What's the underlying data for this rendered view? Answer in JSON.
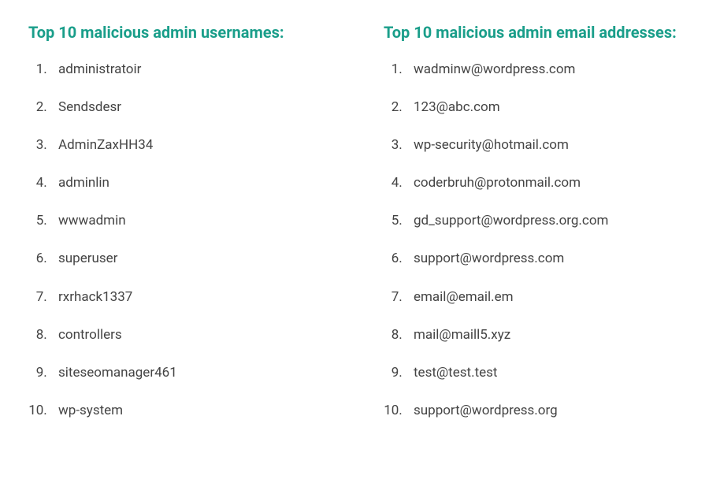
{
  "left": {
    "heading": "Top 10 malicious admin usernames:",
    "items": [
      "administratoir",
      "Sendsdesr",
      "AdminZaxHH34",
      "adminlin",
      "wwwadmin",
      "superuser",
      "rxrhack1337",
      "controllers",
      "siteseomanager461",
      "wp-system"
    ]
  },
  "right": {
    "heading": "Top 10 malicious admin email addresses:",
    "items": [
      "wadminw@wordpress.com",
      "123@abc.com",
      "wp-security@hotmail.com",
      "coderbruh@protonmail.com",
      "gd_support@wordpress.org.com",
      "support@wordpress.com",
      "email@email.em",
      "mail@maill5.xyz",
      "test@test.test",
      "support@wordpress.org"
    ]
  }
}
